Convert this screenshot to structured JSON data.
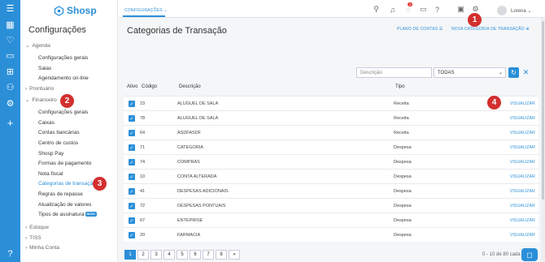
{
  "brand": {
    "name": "Shosp"
  },
  "sidebar": {
    "title": "Configurações",
    "sections": {
      "agenda": {
        "label": "Agenda",
        "items": [
          "Configurações gerais",
          "Salas",
          "Agendamento on-line"
        ]
      },
      "prontuario": {
        "label": "Prontuário"
      },
      "financeiro": {
        "label": "Financeiro",
        "items": [
          "Configurações gerais",
          "Caixas",
          "Contas bancárias",
          "Centro de custos",
          "Shosp Pay",
          "Formas de pagamento",
          "Nota fiscal",
          "Categorias de transação",
          "Regras de repasse",
          "Atualização de valores",
          "Tipos de assinatura"
        ]
      },
      "estoque": {
        "label": "Estoque"
      },
      "tiss": {
        "label": "TISS"
      },
      "minha_conta": {
        "label": "Minha Conta"
      }
    },
    "new_badge": "NOVO"
  },
  "topbar": {
    "breadcrumb": "CONFIGURAÇÕES",
    "notif_badge": "2",
    "user_name": "Lorena"
  },
  "page": {
    "title": "Categorias de Transação",
    "link_plano": "PLANO DE CONTAS",
    "link_nova": "NOVA CATEGORIA DE TRANSAÇÃO"
  },
  "filters": {
    "desc_placeholder": "Descrição",
    "select_value": "TODAS"
  },
  "table": {
    "headers": [
      "Ativo",
      "Código",
      "Descrição",
      "Tipo"
    ],
    "action_label": "VISUALIZAR",
    "rows": [
      {
        "code": "23",
        "desc": "ALUGUEL DE SALA",
        "type": "Receita"
      },
      {
        "code": "78",
        "desc": "ALUGUEL DE SALA",
        "type": "Receita"
      },
      {
        "code": "64",
        "desc": "ASDFASDF",
        "type": "Receita"
      },
      {
        "code": "71",
        "desc": "CATEGORIA",
        "type": "Despesa"
      },
      {
        "code": "74",
        "desc": "COMPRAS",
        "type": "Despesa"
      },
      {
        "code": "10",
        "desc": "CONTA ALTERADA",
        "type": "Despesa"
      },
      {
        "code": "41",
        "desc": "DESPESAS ADICIONAIS",
        "type": "Despesa"
      },
      {
        "code": "72",
        "desc": "DESPESAS PONTUAIS",
        "type": "Despesa"
      },
      {
        "code": "67",
        "desc": "ENTEPRISE",
        "type": "Despesa"
      },
      {
        "code": "20",
        "desc": "FARMACIA",
        "type": "Despesa"
      }
    ]
  },
  "pagination": {
    "pages": [
      "1",
      "2",
      "3",
      "4",
      "5",
      "6",
      "7",
      "8",
      "»"
    ],
    "summary": "0 - 10 de 80 cada"
  },
  "annotations": [
    "1",
    "2",
    "3",
    "4"
  ]
}
